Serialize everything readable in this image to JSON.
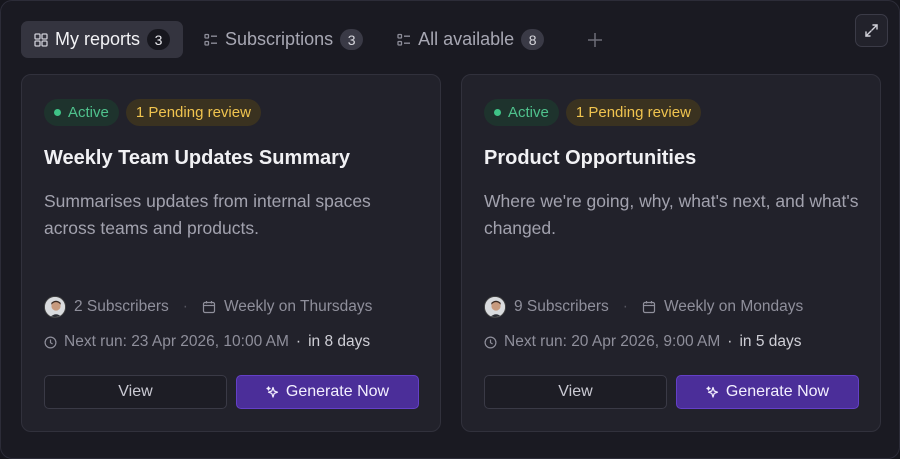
{
  "tabs": [
    {
      "label": "My reports",
      "count": "3",
      "icon": "grid-icon"
    },
    {
      "label": "Subscriptions",
      "count": "3",
      "icon": "list-icon"
    },
    {
      "label": "All available",
      "count": "8",
      "icon": "list-icon"
    }
  ],
  "icons": {
    "add_tab": "plus-icon",
    "expand": "expand-icon",
    "schedule": "calendar-icon",
    "next_run": "clock-icon",
    "generate": "sparkle-icon"
  },
  "colors": {
    "active_badge": "#4fc28d",
    "pending_badge": "#f0c44f",
    "primary_button": "#4b2e99"
  },
  "reports": [
    {
      "status": "Active",
      "pending": "1 Pending review",
      "title": "Weekly Team Updates Summary",
      "description": "Summarises updates from internal spaces across teams and products.",
      "subscribers": "2 Subscribers",
      "schedule": "Weekly on Thursdays",
      "next_run": "Next run: 23 Apr 2026, 10:00 AM",
      "next_run_sep": "·",
      "relative": "in 8 days",
      "view_label": "View",
      "generate_label": "Generate Now"
    },
    {
      "status": "Active",
      "pending": "1 Pending review",
      "title": "Product Opportunities",
      "description": "Where we're going, why, what's next, and what's changed.",
      "subscribers": "9 Subscribers",
      "schedule": "Weekly on Mondays",
      "next_run": "Next run: 20 Apr 2026, 9:00 AM",
      "next_run_sep": "·",
      "relative": "in 5 days",
      "view_label": "View",
      "generate_label": "Generate Now"
    }
  ]
}
